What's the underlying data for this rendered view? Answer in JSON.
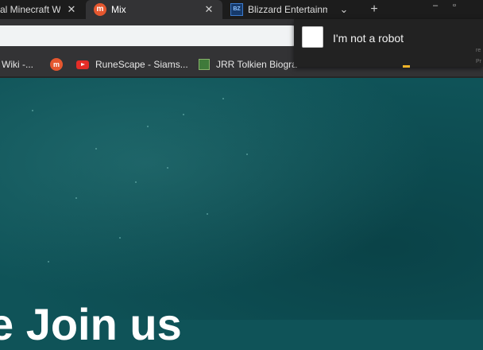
{
  "tabs": [
    {
      "title": "al Minecraft Wiki",
      "icon": "none"
    },
    {
      "title": "Mix",
      "icon": "mix-icon"
    },
    {
      "title": "Blizzard Entertainment",
      "icon": "blizzard-icon"
    }
  ],
  "window_controls": {
    "new_tab": "+",
    "minimize": "–",
    "restore": "▫",
    "chevron": "⌄"
  },
  "bookmarks": [
    {
      "label": "Wiki -...",
      "icon": "none"
    },
    {
      "label": "",
      "icon": "mix-icon"
    },
    {
      "label": "RuneScape - Siams...",
      "icon": "youtube-icon"
    },
    {
      "label": "JRR Tolkien Biogra",
      "icon": "image-icon"
    }
  ],
  "captcha": {
    "label": "I'm not a robot",
    "fine_print_1": "re",
    "fine_print_2": "Pr"
  },
  "page": {
    "heading": "e Join us"
  },
  "colors": {
    "page_bg": "#0f5358",
    "chrome_dark": "#1c1c1c",
    "toolbar": "#333335",
    "accent": "#e5572f"
  }
}
